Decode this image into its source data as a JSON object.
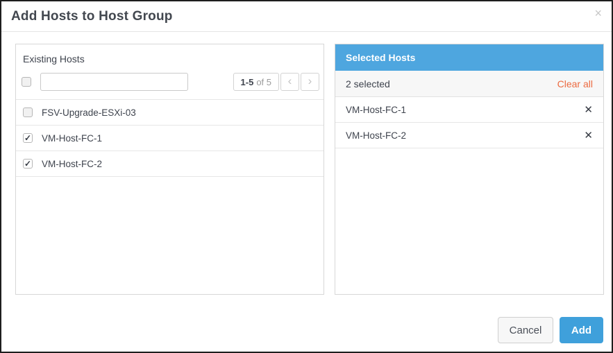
{
  "dialog": {
    "title": "Add Hosts to Host Group"
  },
  "icons": {
    "close": "×",
    "check": "✓",
    "remove": "✕",
    "prev": "‹",
    "next": "›"
  },
  "left_panel": {
    "title": "Existing Hosts",
    "select_all_checked": false,
    "search": {
      "value": ""
    },
    "pagination": {
      "range": "1-5",
      "of_label": "of 5"
    },
    "hosts": [
      {
        "name": "FSV-Upgrade-ESXi-03",
        "checked": false
      },
      {
        "name": "VM-Host-FC-1",
        "checked": true
      },
      {
        "name": "VM-Host-FC-2",
        "checked": true
      }
    ]
  },
  "right_panel": {
    "title": "Selected Hosts",
    "selected_count": "2 selected",
    "clear_all_label": "Clear all",
    "hosts": [
      {
        "name": "VM-Host-FC-1"
      },
      {
        "name": "VM-Host-FC-2"
      }
    ]
  },
  "footer": {
    "cancel_label": "Cancel",
    "add_label": "Add"
  },
  "colors": {
    "accent_blue": "#4ea6df",
    "add_button_blue": "#3fa0db",
    "clear_all_orange": "#ec6b41"
  }
}
